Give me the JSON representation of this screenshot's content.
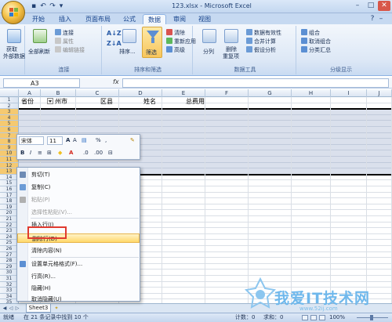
{
  "title_bar": {
    "title": "123.xlsx - Microsoft Excel"
  },
  "ribbon_tabs": [
    "开始",
    "插入",
    "页面布局",
    "公式",
    "数据",
    "审阅",
    "视图"
  ],
  "active_tab": "数据",
  "ribbon": {
    "get_external": {
      "line1": "获取",
      "line2": "外部数据"
    },
    "refresh_all": {
      "line1": "全部刷新"
    },
    "connections": "连接",
    "properties": "属性",
    "edit_links": "编辑链接",
    "sort_label": "排序...",
    "filter_label": "筛选",
    "clear": "清除",
    "reapply": "重新应用",
    "advanced": "高级",
    "split_columns": "分列",
    "remove_duplicates": {
      "line1": "删除",
      "line2": "重复项"
    },
    "data_validation": "数据有效性",
    "consolidate": "合并计算",
    "what_if": "假设分析",
    "group": "组合",
    "ungroup": "取消组合",
    "subtotal": "分类汇总",
    "group_labels": {
      "connections": "连接",
      "sort_filter": "排序和筛选",
      "data_tools": "数据工具",
      "outline": "分级显示"
    }
  },
  "formula_bar": {
    "cell_ref": "A3",
    "fx": "fx",
    "formula": ""
  },
  "columns": [
    "A",
    "B",
    "C",
    "D",
    "E",
    "F",
    "G",
    "H",
    "I",
    "J"
  ],
  "rows": [
    "1",
    "2",
    "3",
    "4",
    "5",
    "6",
    "7",
    "8",
    "9",
    "10",
    "11",
    "12",
    "13",
    "14",
    "15",
    "16",
    "17",
    "18",
    "19",
    "20",
    "21",
    "22",
    "23",
    "24",
    "25",
    "26",
    "27",
    "28",
    "29",
    "30",
    "31",
    "32",
    "33",
    "34",
    "35",
    "36"
  ],
  "header_cells": [
    "省份",
    "州市",
    "区县",
    "姓名",
    "总费用"
  ],
  "mini_toolbar": {
    "font": "宋体",
    "size": "11",
    "percent": "%"
  },
  "context_menu": [
    {
      "label": "剪切(T)",
      "icon": "scissors-icon",
      "enabled": true
    },
    {
      "label": "复制(C)",
      "icon": "copy-icon",
      "enabled": true
    },
    {
      "label": "粘贴(P)",
      "icon": "paste-icon",
      "enabled": false
    },
    {
      "label": "选择性粘贴(V)...",
      "icon": "",
      "enabled": false
    },
    {
      "label": "插入行(I)",
      "icon": "",
      "enabled": true
    },
    {
      "label": "删除行(D)",
      "icon": "",
      "enabled": true,
      "highlighted": true
    },
    {
      "label": "清除内容(N)",
      "icon": "",
      "enabled": true
    },
    {
      "label": "设置单元格格式(F)...",
      "icon": "format-cells-icon",
      "enabled": true
    },
    {
      "label": "行高(R)...",
      "icon": "",
      "enabled": true
    },
    {
      "label": "隐藏(H)",
      "icon": "",
      "enabled": true
    },
    {
      "label": "取消隐藏(U)",
      "icon": "",
      "enabled": true
    }
  ],
  "sheet_tabs": [
    "Sheet3"
  ],
  "status_bar": {
    "ready": "就绪",
    "filter_status": "在 21 条记录中找到 10 个",
    "count": "计数：0",
    "numeric_count": "求和：0",
    "zoom": "100%"
  },
  "watermark": {
    "text": "我爱IT技术网",
    "sub": "www.52ij.com"
  }
}
